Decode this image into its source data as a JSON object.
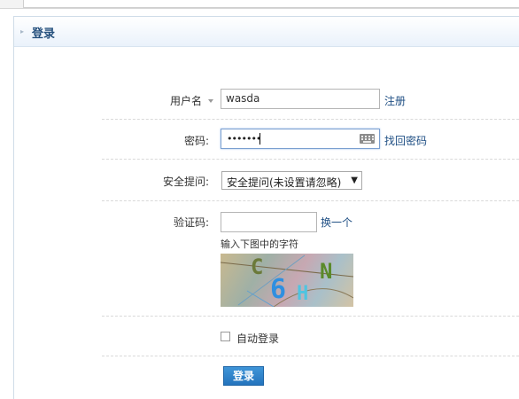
{
  "panel": {
    "title": "登录"
  },
  "form": {
    "username": {
      "label": "用户名",
      "value": "wasda",
      "link": "注册"
    },
    "password": {
      "label": "密码:",
      "value": "•••••••",
      "link": "找回密码"
    },
    "security": {
      "label": "安全提问:",
      "selected": "安全提问(未设置请忽略)"
    },
    "captcha": {
      "label": "验证码:",
      "value": "",
      "refresh_link": "换一个",
      "hint": "输入下图中的字符",
      "chars": "C6HN"
    },
    "remember": {
      "label": "自动登录",
      "checked": false
    },
    "submit": {
      "label": "登录"
    }
  },
  "colors": {
    "link": "#1f4f84",
    "title": "#25507d",
    "button": "#2a7fc8"
  }
}
